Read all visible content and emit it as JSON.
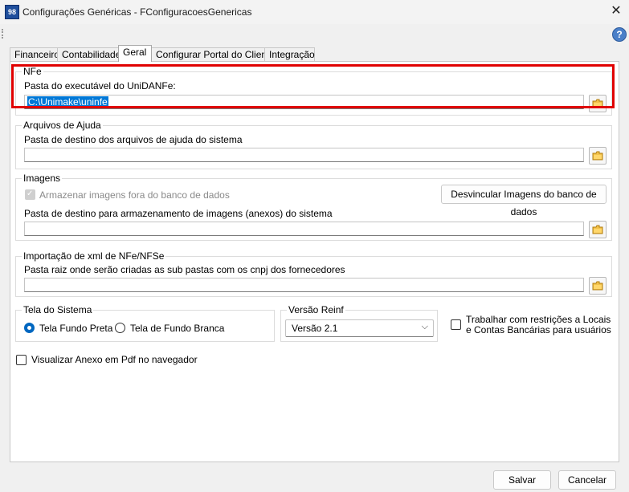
{
  "window": {
    "app_icon_text": "98",
    "title": "Configurações Genéricas - FConfiguracoesGenericas",
    "close_symbol": "✕",
    "help_symbol": "?"
  },
  "tabs": [
    {
      "label": "Financeiro",
      "active": false
    },
    {
      "label": "Contabilidade",
      "active": false
    },
    {
      "label": "Geral",
      "active": true
    },
    {
      "label": "Configurar Portal do Cliente",
      "active": false
    },
    {
      "label": "Integração",
      "active": false
    }
  ],
  "nfe": {
    "legend": "NFe",
    "label": "Pasta do executável do UniDANFe:",
    "value": "C:\\Unimake\\uninfe"
  },
  "ajuda": {
    "legend": "Arquivos de Ajuda",
    "label": "Pasta de destino dos arquivos de ajuda do sistema",
    "value": ""
  },
  "imagens": {
    "legend": "Imagens",
    "checkbox_label": "Armazenar imagens fora do banco de dados",
    "checkbox_checked": true,
    "unlink_button": "Desvincular Imagens do banco de dados",
    "label": "Pasta de destino para armazenamento de imagens (anexos) do sistema",
    "value": ""
  },
  "xml": {
    "legend": "Importação de xml de NFe/NFSe",
    "label": "Pasta raiz onde serão criadas as sub pastas com os cnpj dos fornecedores",
    "value": ""
  },
  "tela": {
    "legend": "Tela do Sistema",
    "option1": "Tela Fundo Preta",
    "option2": "Tela de Fundo Branca",
    "selected": "option1"
  },
  "reinf": {
    "legend": "Versão Reinf",
    "selected": "Versão 2.1"
  },
  "restricoes": {
    "line1": "Trabalhar com restrições a Locais",
    "line2": "e Contas Bancárias para usuários",
    "checked": false
  },
  "anexo_pdf": {
    "label": "Visualizar Anexo em Pdf no navegador",
    "checked": false
  },
  "footer": {
    "save": "Salvar",
    "cancel": "Cancelar"
  },
  "colors": {
    "highlight": "#e00000",
    "selection": "#0078d7",
    "radio_accent": "#0067c0"
  }
}
